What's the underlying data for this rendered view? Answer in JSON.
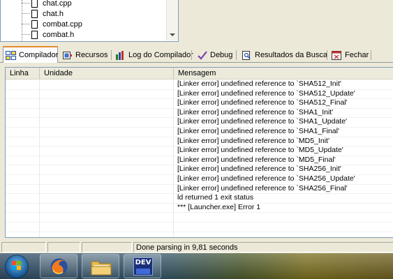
{
  "project_tree": {
    "files": [
      "chat.cpp",
      "chat.h",
      "combat.cpp",
      "combat.h"
    ]
  },
  "tabs": [
    {
      "label": "Compilador",
      "icon": "compiler-grid-icon",
      "active": true
    },
    {
      "label": "Recursos",
      "icon": "resources-icon",
      "active": false
    },
    {
      "label": "Log do Compilador",
      "icon": "bar-chart-icon",
      "active": false
    },
    {
      "label": "Debug",
      "icon": "checkmark-icon",
      "active": false
    },
    {
      "label": "Resultados da Busca",
      "icon": "search-results-icon",
      "active": false
    },
    {
      "label": "Fechar",
      "icon": "close-tab-icon",
      "active": false
    }
  ],
  "table": {
    "columns": [
      "Linha",
      "Unidade",
      "Mensagem"
    ],
    "rows": [
      {
        "linha": "",
        "unidade": "",
        "mensagem": "[Linker error] undefined reference to `SHA512_Init'"
      },
      {
        "linha": "",
        "unidade": "",
        "mensagem": "[Linker error] undefined reference to `SHA512_Update'"
      },
      {
        "linha": "",
        "unidade": "",
        "mensagem": "[Linker error] undefined reference to `SHA512_Final'"
      },
      {
        "linha": "",
        "unidade": "",
        "mensagem": "[Linker error] undefined reference to `SHA1_Init'"
      },
      {
        "linha": "",
        "unidade": "",
        "mensagem": "[Linker error] undefined reference to `SHA1_Update'"
      },
      {
        "linha": "",
        "unidade": "",
        "mensagem": "[Linker error] undefined reference to `SHA1_Final'"
      },
      {
        "linha": "",
        "unidade": "",
        "mensagem": "[Linker error] undefined reference to `MD5_Init'"
      },
      {
        "linha": "",
        "unidade": "",
        "mensagem": "[Linker error] undefined reference to `MD5_Update'"
      },
      {
        "linha": "",
        "unidade": "",
        "mensagem": "[Linker error] undefined reference to `MD5_Final'"
      },
      {
        "linha": "",
        "unidade": "",
        "mensagem": "[Linker error] undefined reference to `SHA256_Init'"
      },
      {
        "linha": "",
        "unidade": "",
        "mensagem": "[Linker error] undefined reference to `SHA256_Update'"
      },
      {
        "linha": "",
        "unidade": "",
        "mensagem": "[Linker error] undefined reference to `SHA256_Final'"
      },
      {
        "linha": "",
        "unidade": "",
        "mensagem": "ld returned 1 exit status"
      },
      {
        "linha": "",
        "unidade": "",
        "mensagem": "*** [Launcher.exe] Error 1"
      }
    ]
  },
  "status_bar": {
    "message": "Done parsing in 9,81 seconds"
  },
  "taskbar": {
    "items": [
      {
        "name": "start-button",
        "icon": "windows-orb-icon"
      },
      {
        "name": "firefox",
        "icon": "firefox-icon"
      },
      {
        "name": "file-explorer",
        "icon": "folder-icon"
      },
      {
        "name": "dev-cpp",
        "icon": "dev-cpp-icon",
        "label": "DEV"
      }
    ]
  },
  "colors": {
    "active_tab_accent": "#e68b2c",
    "dialog_background": "#ece9d8",
    "border_blue": "#7f9db9"
  }
}
